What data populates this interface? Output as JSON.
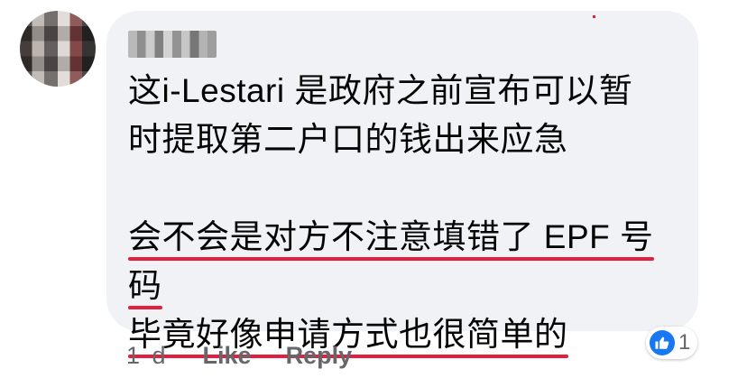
{
  "comment": {
    "lines_paragraph1": [
      "这i-Lestari 是政府之前宣布可以暂",
      "时提取第二户口的钱出来应急"
    ],
    "lines_paragraph2": [
      "会不会是对方不注意填错了 EPF 号",
      "码",
      "毕竟好像申请方式也很简单的"
    ]
  },
  "meta": {
    "time": "1 d",
    "like_label": "Like",
    "reply_label": "Reply"
  },
  "reactions": {
    "count": "1",
    "icon": "thumbs-up-icon",
    "accent": "#1877f2"
  },
  "colors": {
    "bubble": "#f0f2f5",
    "underline": "#e41e3f",
    "text": "#050505",
    "meta_text": "#65676b"
  }
}
